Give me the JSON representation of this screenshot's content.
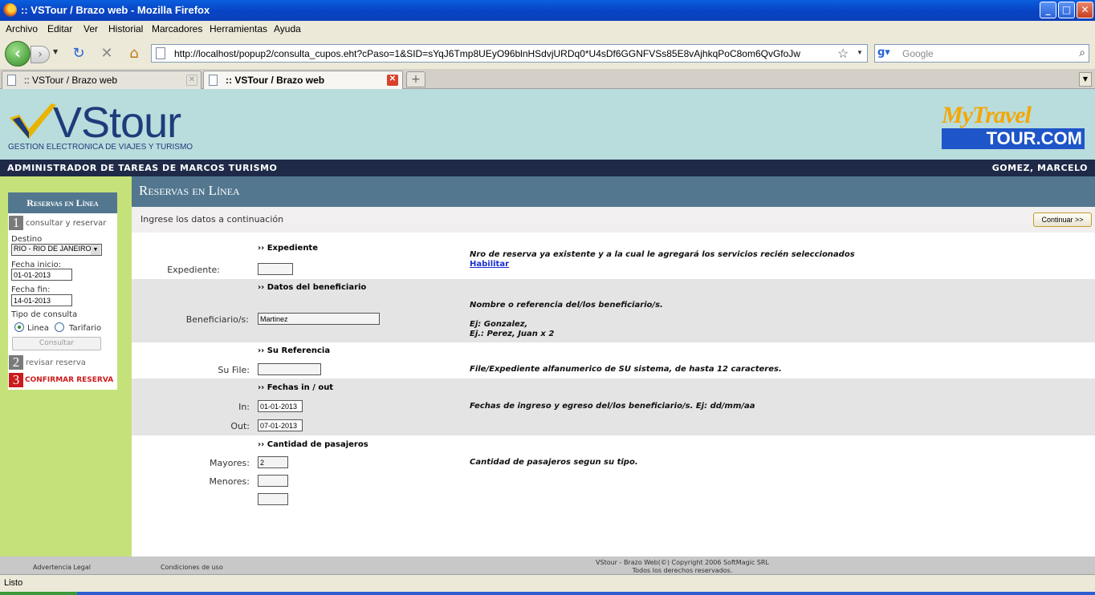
{
  "window": {
    "title": ":: VSTour / Brazo web - Mozilla Firefox",
    "minimize": "_",
    "maximize": "□",
    "close": "✕"
  },
  "menu": [
    "Archivo",
    "Editar",
    "Ver",
    "Historial",
    "Marcadores",
    "Herramientas",
    "Ayuda"
  ],
  "toolbar": {
    "url": "http://localhost/popup2/consulta_cupos.eht?cPaso=1&SID=sYqJ6Tmp8UEyO96blnHSdvjURDq0*U4sDf6GGNFVSs85E8vAjhkqPoC8om6QvGfoJw",
    "search_placeholder": "Google"
  },
  "tabs": [
    {
      "label": ":: VSTour / Brazo web",
      "active": false
    },
    {
      "label": ":: VSTour / Brazo web",
      "active": true
    }
  ],
  "banner": {
    "logo_text": "VStour",
    "tagline": "GESTION ELECTRONICA DE VIAJES Y TURISMO",
    "partner_top": "MyTravel",
    "partner_bottom": "TOUR.COM"
  },
  "admin_bar": {
    "left": "ADMINISTRADOR DE TAREAS DE MARCOS TURISMO",
    "right": "GOMEZ, MARCELO"
  },
  "sidebar": {
    "title": "Reservas en Línea",
    "step1_num": "1",
    "step1_label": "consultar y reservar",
    "destino_label": "Destino",
    "destino_value": "RIO - RIO DE JANEIRO",
    "fecha_inicio_label": "Fecha inicio:",
    "fecha_inicio_value": "01-01-2013",
    "fecha_fin_label": "Fecha fin:",
    "fecha_fin_value": "14-01-2013",
    "tipo_label": "Tipo de consulta",
    "option_linea": "Linea",
    "option_tarifario": "Tarifario",
    "consultar_button": "Consultar",
    "step2_num": "2",
    "step2_label": "revisar reserva",
    "step3_num": "3",
    "step3_label": "CONFIRMAR RESERVA"
  },
  "main": {
    "title": "Reservas en Línea",
    "intro": "Ingrese los datos a continuación",
    "continue_button": "Continuar >>",
    "sections": {
      "expediente": {
        "title": "›› Expediente",
        "label": "Expediente:",
        "value": "",
        "note": "Nro de reserva ya existente y a la cual le agregará los servicios recién seleccionados",
        "link": "Habilitar"
      },
      "beneficiario": {
        "title": "›› Datos del beneficiario",
        "label": "Beneficiario/s:",
        "value": "Martinez",
        "note1": "Nombre o referencia del/los beneficiario/s.",
        "note2": "Ej: Gonzalez,",
        "note3": "Ej.: Perez, Juan x 2"
      },
      "referencia": {
        "title": "›› Su Referencia",
        "label": "Su File:",
        "value": "",
        "note": "File/Expediente alfanumerico de SU sistema, de hasta 12 caracteres."
      },
      "fechas": {
        "title": "›› Fechas in / out",
        "in_label": "In:",
        "in_value": "01-01-2013",
        "out_label": "Out:",
        "out_value": "07-01-2013",
        "note": "Fechas de ingreso y egreso del/los beneficiario/s. Ej: dd/mm/aa"
      },
      "pasajeros": {
        "title": "›› Cantidad de pasajeros",
        "mayores_label": "Mayores:",
        "mayores_value": "2",
        "menores_label": "Menores:",
        "menores_value": "",
        "extra_value": "",
        "note": "Cantidad de pasajeros segun su tipo."
      }
    }
  },
  "footer": {
    "legal": "Advertencia Legal",
    "conditions": "Condiciones de uso",
    "copyright1": "VStour - Brazo Web(©) Copyright 2006 SoftMagic SRL",
    "copyright2": "Todos los derechos reservados."
  },
  "status": "Listo",
  "colors": {
    "banner": "#b9dcdd",
    "admin_bar": "#1e2a47",
    "header": "#52778f",
    "sidebar": "#c5e27a",
    "step3": "#cc1b1b"
  }
}
